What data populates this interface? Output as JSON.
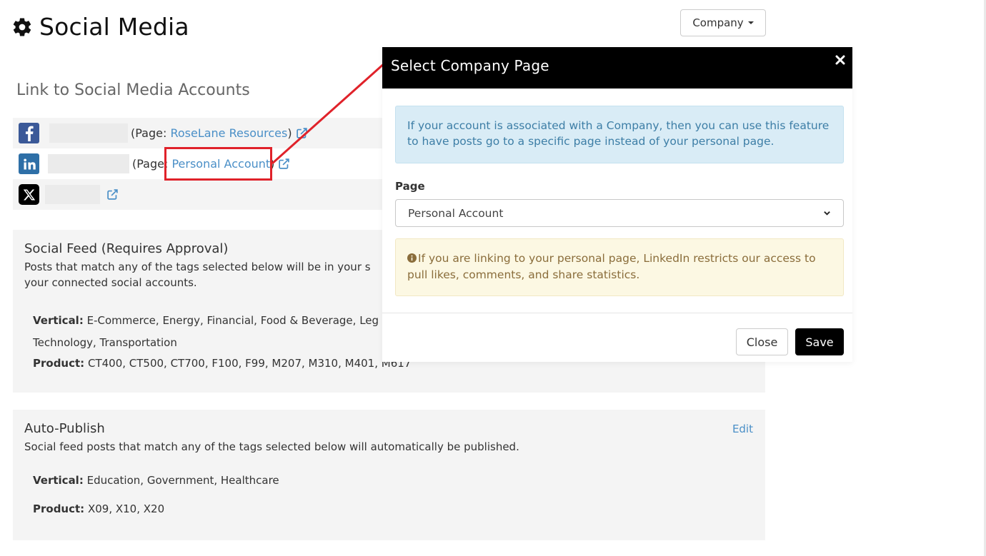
{
  "header": {
    "title": "Social Media",
    "icon": "gear-icon",
    "company_dropdown_label": "Company"
  },
  "link_section": {
    "heading": "Link to Social Media Accounts",
    "accounts": [
      {
        "network": "facebook",
        "icon": "facebook-icon",
        "icon_color": "#3b5998",
        "page_prefix": "(Page: ",
        "page_name": "RoseLane Resources",
        "page_suffix": ")"
      },
      {
        "network": "linkedin",
        "icon": "linkedin-icon",
        "icon_color": "#2e6fa7",
        "page_prefix": "(Page: ",
        "page_name": "Personal Account",
        "page_suffix": ")"
      },
      {
        "network": "x",
        "icon": "x-icon",
        "icon_color": "#000000"
      }
    ]
  },
  "social_feed": {
    "title": "Social Feed (Requires Approval)",
    "description_line1": "Posts that match any of the tags selected below will be in your s",
    "description_line2": "your connected social accounts.",
    "vertical_label": "Vertical:",
    "vertical_value_line1": "E-Commerce, Energy, Financial, Food & Beverage, Leg",
    "vertical_value_line2": "Technology, Transportation",
    "product_label": "Product:",
    "product_value": "CT400, CT500, CT700, F100, F99, M207, M310, M401, M617"
  },
  "auto_publish": {
    "title": "Auto-Publish",
    "edit_label": "Edit",
    "description": "Social feed posts that match any of the tags selected below will automatically be published.",
    "vertical_label": "Vertical:",
    "vertical_value": "Education, Government, Healthcare",
    "product_label": "Product:",
    "product_value": "X09, X10, X20"
  },
  "modal": {
    "title": "Select Company Page",
    "close_icon": "close-icon",
    "info_text": "If your account is associated with a Company, then you can use this feature to have posts go to a specific page instead of your personal page.",
    "page_label": "Page",
    "page_selected": "Personal Account",
    "warning_text": "If you are linking to your personal page, LinkedIn restricts our access to pull likes, comments, and share statistics.",
    "close_button": "Close",
    "save_button": "Save"
  },
  "colors": {
    "link": "#4a8fc7",
    "annotation": "#e0222a",
    "modal_header": "#000000",
    "info_bg": "#d9ecf6",
    "warning_bg": "#fcf8e3"
  }
}
